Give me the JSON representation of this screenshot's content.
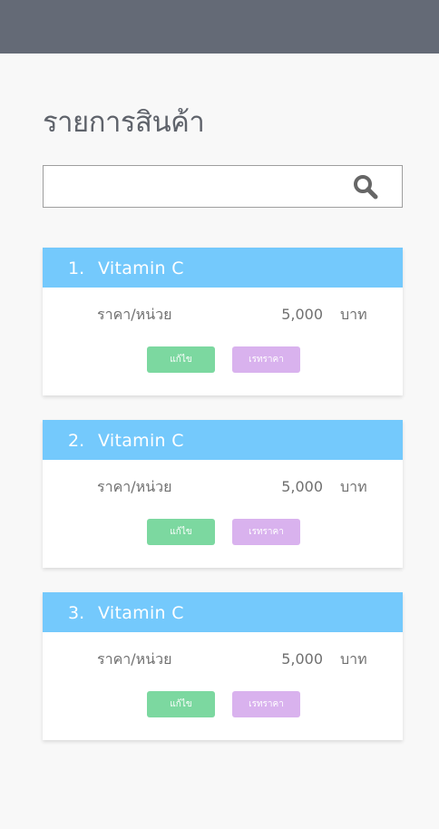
{
  "page": {
    "title": "รายการสินค้า"
  },
  "search": {
    "value": "",
    "placeholder": "",
    "icon": "search-icon"
  },
  "colors": {
    "topbar": "#646a76",
    "card_header": "#74c9fc",
    "edit_button": "#7cd8a0",
    "price_button": "#d9b2ee"
  },
  "products": [
    {
      "index": "1.",
      "name": "Vitamin C",
      "price_label": "ราคา/หน่วย",
      "price": "5,000",
      "unit": "บาท",
      "edit_label": "แก้ไข",
      "price_button_label": "เรทราคา"
    },
    {
      "index": "2.",
      "name": "Vitamin C",
      "price_label": "ราคา/หน่วย",
      "price": "5,000",
      "unit": "บาท",
      "edit_label": "แก้ไข",
      "price_button_label": "เรทราคา"
    },
    {
      "index": "3.",
      "name": "Vitamin C",
      "price_label": "ราคา/หน่วย",
      "price": "5,000",
      "unit": "บาท",
      "edit_label": "แก้ไข",
      "price_button_label": "เรทราคา"
    }
  ]
}
